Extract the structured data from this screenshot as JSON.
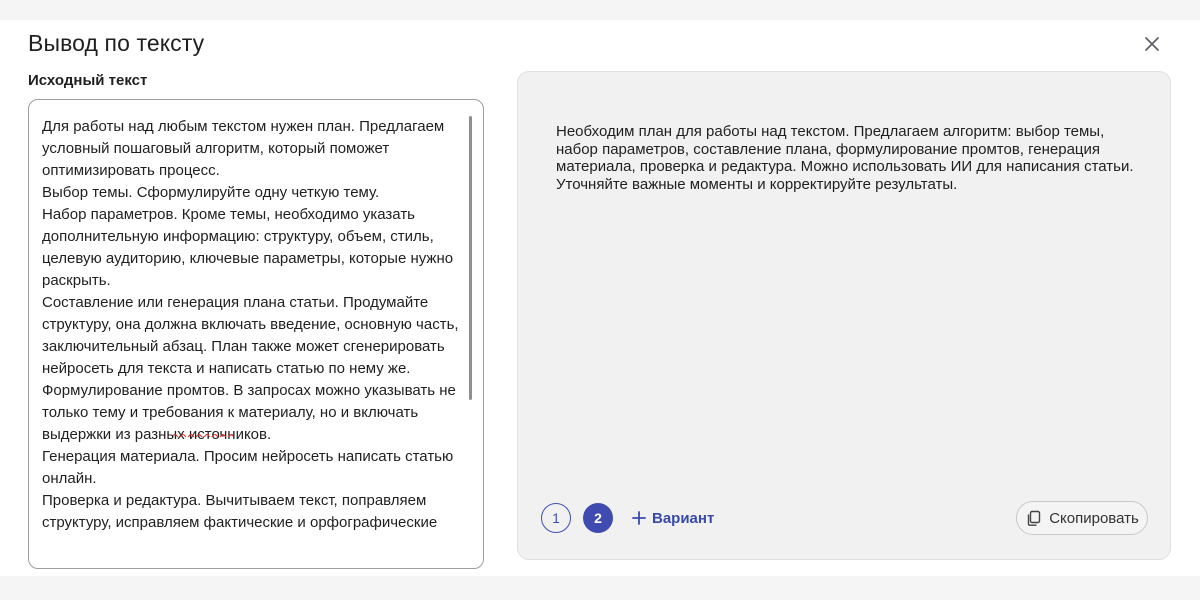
{
  "dialog": {
    "title": "Вывод по тексту",
    "close_icon": "close-icon"
  },
  "source": {
    "label": "Исходный текст",
    "text": "Для работы над любым текстом нужен план. Предлагаем условный пошаговый алгоритм, который поможет оптимизировать процесс.\nВыбор темы. Сформулируйте одну четкую тему.\nНабор параметров. Кроме темы, необходимо указать дополнительную информацию: структуру, объем, стиль, целевую аудиторию, ключевые параметры, которые нужно раскрыть.\nСоставление или генерация плана статьи. Продумайте структуру, она должна включать введение, основную часть, заключительный абзац. План также может сгенерировать нейросеть для текста и написать статью по нему же.\nФормулирование промтов. В запросах можно указывать не только тему и требования к материалу, но и включать выдержки из разных источников.\nГенерация материала. Просим нейросеть написать статью онлайн.\nПроверка и редактура. Вычитываем текст, поправляем структуру, исправляем фактические и орфографические"
  },
  "result": {
    "text": "Необходим план для работы над текстом. Предлагаем алгоритм: выбор темы, набор параметров, составление плана, формулирование промтов, генерация материала, проверка и редактура. Можно использовать ИИ для написания статьи. Уточняйте важные моменты и корректируйте результаты.",
    "variants": [
      "1",
      "2"
    ],
    "active_variant": "2",
    "add_variant_label": "Вариант",
    "copy_label": "Скопировать"
  },
  "colors": {
    "accent": "#3f4bb0",
    "panel_bg": "#f1f1f1",
    "page_bg": "#f5f5f5"
  }
}
